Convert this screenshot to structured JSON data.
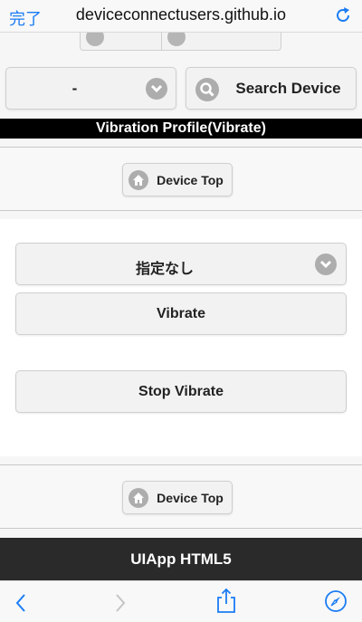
{
  "browser": {
    "done_label": "完了",
    "url": "deviceconnectusers.github.io"
  },
  "controls": {
    "device_select_value": "-",
    "search_label": "Search Device"
  },
  "profile": {
    "title": "Vibration Profile(Vibrate)"
  },
  "nav": {
    "device_top_label": "Device Top"
  },
  "vibration": {
    "pattern_select_value": "指定なし",
    "vibrate_label": "Vibrate",
    "stop_label": "Stop Vibrate"
  },
  "footer": {
    "text": "UIApp HTML5"
  },
  "colors": {
    "accent": "#1a7cf4",
    "header_bg": "#000000",
    "footer_bg": "#2a2a2a"
  },
  "icons": [
    "reload-icon",
    "chevron-down-icon",
    "search-icon",
    "home-icon",
    "back-icon",
    "forward-icon",
    "share-icon",
    "compass-icon"
  ]
}
